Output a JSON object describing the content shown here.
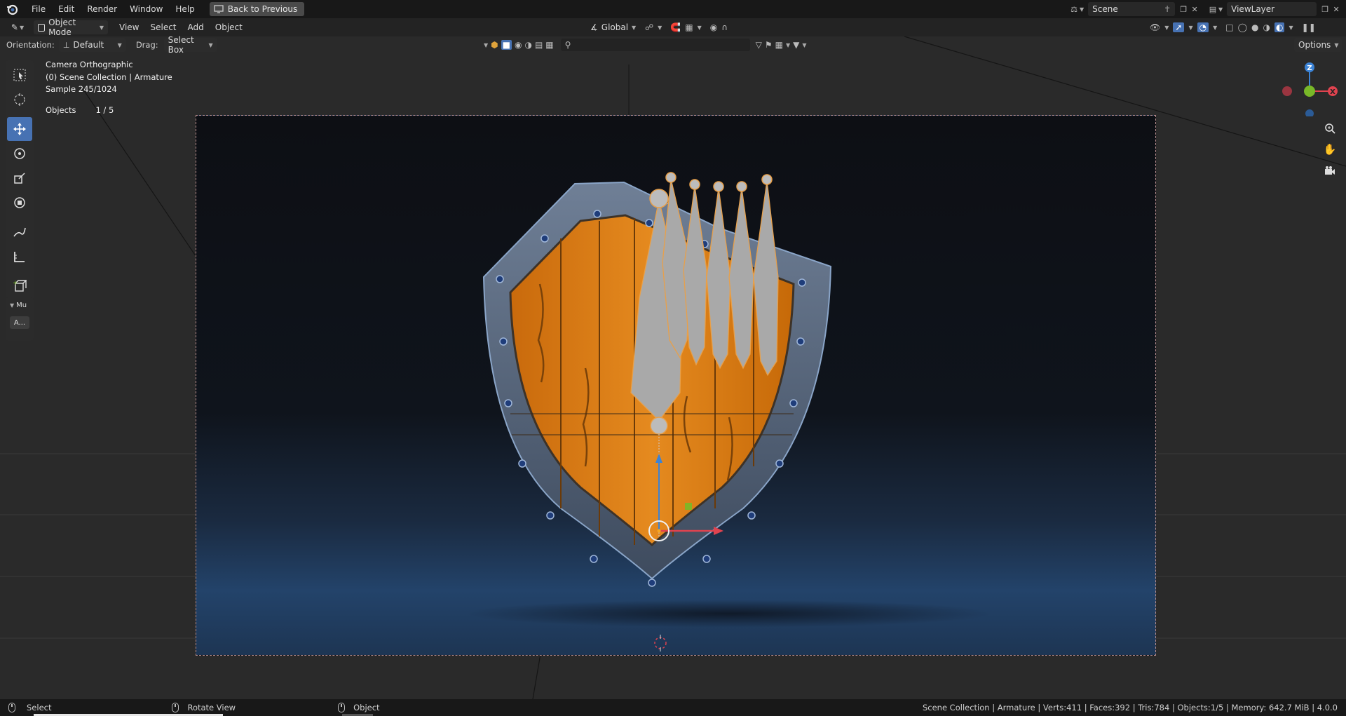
{
  "menubar": {
    "items": [
      "File",
      "Edit",
      "Render",
      "Window",
      "Help"
    ],
    "back_button": "Back to Previous",
    "scene_name": "Scene",
    "view_layer": "ViewLayer"
  },
  "header": {
    "mode": "Object Mode",
    "menus": [
      "View",
      "Select",
      "Add",
      "Object"
    ],
    "transform_orientation": "Global",
    "options_label": "Options"
  },
  "tool_settings": {
    "orientation_label": "Orientation:",
    "orientation_value": "Default",
    "drag_label": "Drag:",
    "drag_value": "Select Box"
  },
  "viewport_info": {
    "view_name": "Camera Orthographic",
    "collection": "(0) Scene Collection | Armature",
    "sample": "Sample 245/1024",
    "objects_label": "Objects",
    "objects_value": "1 / 5"
  },
  "toolbar": {
    "panel_label": "Mu",
    "panel_button": "A..."
  },
  "gizmo": {
    "axis_z": "Z",
    "axis_y": "Y",
    "axis_x": "X",
    "color_x": "#e0434f",
    "color_y": "#79b828",
    "color_z": "#3b83d6"
  },
  "statusbar": {
    "left_action": "Select",
    "middle_action": "Rotate View",
    "right_action": "Object",
    "stats": "Scene Collection | Armature | Verts:411 | Faces:392 | Tris:784 | Objects:1/5 | Memory: 642.7 MiB | 4.0.0"
  },
  "colors": {
    "accent": "#4772b3",
    "wood": "#d97b12",
    "metal_rim": "#5f6f86",
    "bone_outline": "#e8a04a"
  }
}
